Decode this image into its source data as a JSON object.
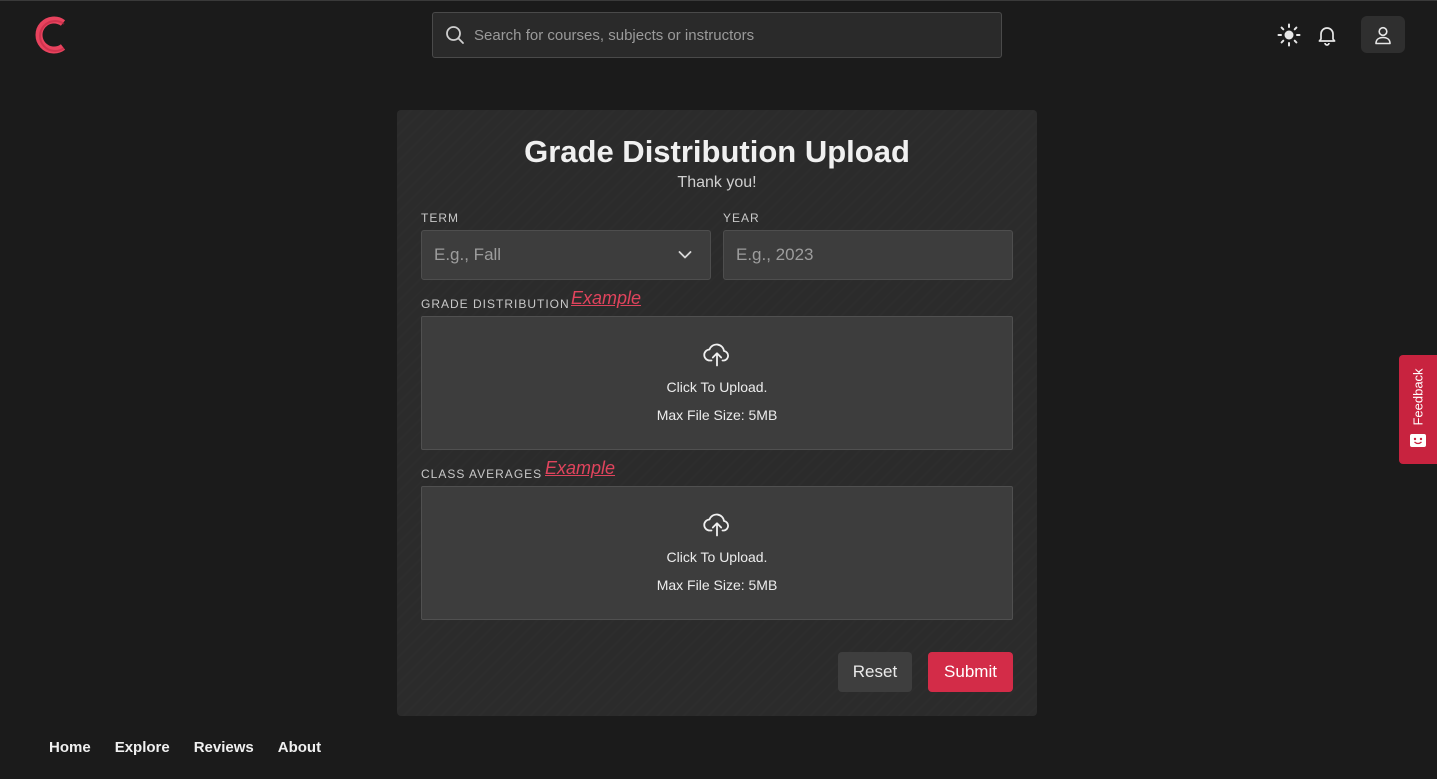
{
  "header": {
    "logo_letter": "C",
    "search_placeholder": "Search for courses, subjects or instructors"
  },
  "form": {
    "title": "Grade Distribution Upload",
    "subtitle": "Thank you!",
    "term_label": "TERM",
    "term_placeholder": "E.g., Fall",
    "year_label": "YEAR",
    "year_placeholder": "E.g., 2023",
    "grade_distribution_label": "GRADE DISTRIBUTION",
    "class_averages_label": "CLASS AVERAGES",
    "example_link": "Example",
    "upload_text": "Click To Upload.",
    "max_size_text": "Max File Size: 5MB",
    "reset_label": "Reset",
    "submit_label": "Submit"
  },
  "feedback": {
    "label": "Feedback"
  },
  "footer": {
    "links": [
      "Home",
      "Explore",
      "Reviews",
      "About"
    ]
  },
  "colors": {
    "accent": "#d32c48",
    "background": "#1b1b1b",
    "card": "#2b2b2b"
  }
}
